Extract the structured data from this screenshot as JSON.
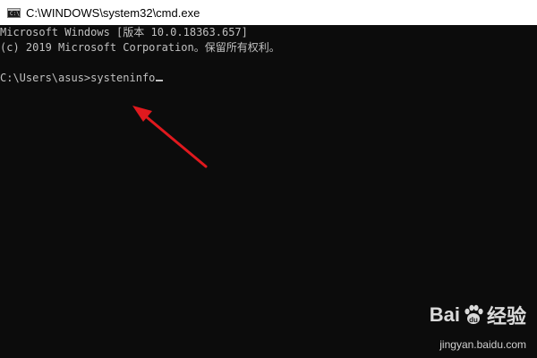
{
  "window": {
    "title": "C:\\WINDOWS\\system32\\cmd.exe",
    "icon": "cmd-icon"
  },
  "console": {
    "lines": [
      "Microsoft Windows [版本 10.0.18363.657]",
      "(c) 2019 Microsoft Corporation。保留所有权利。"
    ],
    "prompt": "C:\\Users\\asus>",
    "command": "systeninfo"
  },
  "annotation": {
    "color": "#e0191e"
  },
  "watermark": {
    "brand_left": "Bai",
    "brand_right": "经验",
    "url": "jingyan.baidu.com"
  },
  "colors": {
    "console_background": "#0c0c0c",
    "console_text": "#c0c0c0",
    "titlebar": "#ffffff"
  }
}
